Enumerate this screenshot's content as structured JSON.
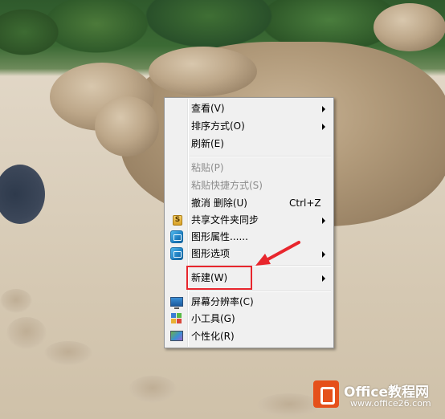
{
  "colors": {
    "annotation_red": "#e8262d",
    "menu_background": "#f0f0f0",
    "disabled_text": "#8d8d8d",
    "watermark_orange": "#e5501b"
  },
  "context_menu": {
    "items": [
      {
        "label": "查看(V)",
        "submenu": true
      },
      {
        "label": "排序方式(O)",
        "submenu": true
      },
      {
        "label": "刷新(E)"
      },
      {
        "label": "粘贴(P)",
        "disabled": true
      },
      {
        "label": "粘贴快捷方式(S)",
        "disabled": true
      },
      {
        "label": "撤消 删除(U)",
        "shortcut": "Ctrl+Z"
      },
      {
        "label": "共享文件夹同步",
        "icon": "share-sync-icon",
        "icon_text": "S",
        "submenu": true
      },
      {
        "label": "图形属性......",
        "icon": "graphics-properties-icon"
      },
      {
        "label": "图形选项",
        "icon": "graphics-options-icon",
        "submenu": true
      },
      {
        "label": "新建(W)",
        "submenu": true,
        "highlighted": true
      },
      {
        "label": "屏幕分辨率(C)",
        "icon": "monitor-icon"
      },
      {
        "label": "小工具(G)",
        "icon": "gadgets-icon"
      },
      {
        "label": "个性化(R)",
        "icon": "personalize-icon"
      }
    ]
  },
  "watermark": {
    "title": "Office教程网",
    "url": "www.office26.com"
  }
}
